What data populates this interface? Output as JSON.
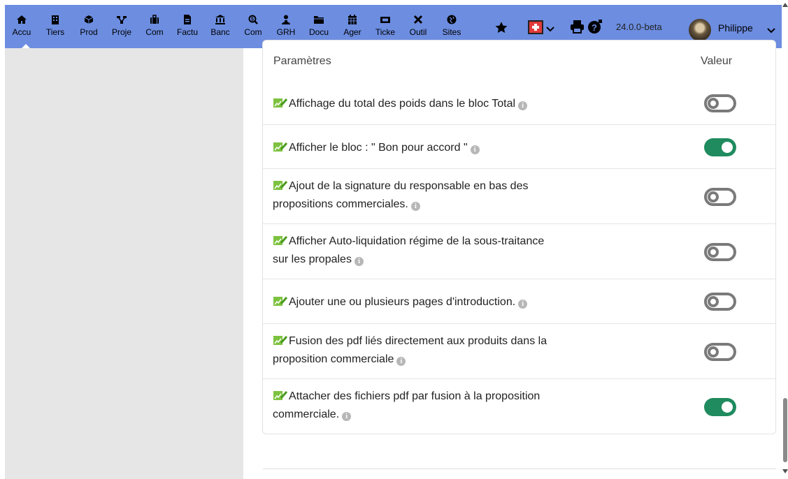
{
  "topbar": {
    "menu": [
      {
        "id": "home",
        "label": "Accu",
        "icon": "home-icon"
      },
      {
        "id": "thirdparties",
        "label": "Tiers",
        "icon": "building-icon"
      },
      {
        "id": "products",
        "label": "Prod",
        "icon": "cube-icon"
      },
      {
        "id": "projects",
        "label": "Proje",
        "icon": "project-icon"
      },
      {
        "id": "commercial",
        "label": "Com",
        "icon": "suitcase-icon"
      },
      {
        "id": "billing",
        "label": "Factu",
        "icon": "invoice-icon"
      },
      {
        "id": "bank",
        "label": "Banc",
        "icon": "bank-icon"
      },
      {
        "id": "accounting",
        "label": "Com",
        "icon": "search-dollar-icon"
      },
      {
        "id": "hrm",
        "label": "GRH",
        "icon": "users-icon"
      },
      {
        "id": "documents",
        "label": "Docu",
        "icon": "folder-icon"
      },
      {
        "id": "agenda",
        "label": "Ager",
        "icon": "calendar-icon"
      },
      {
        "id": "ticket",
        "label": "Ticke",
        "icon": "ticket-icon"
      },
      {
        "id": "tools",
        "label": "Outil",
        "icon": "tools-icon"
      },
      {
        "id": "sites",
        "label": "Sites",
        "icon": "globe-icon"
      }
    ],
    "version": "24.0.0-beta",
    "username": "Philippe",
    "colors": {
      "bar": "#6c8de0",
      "flag": "#e23b3b"
    }
  },
  "table": {
    "col_param": "Paramètres",
    "col_value": "Valeur",
    "rows": [
      {
        "l1": "Affichage du total des poids dans le bloc Total",
        "l2": "",
        "on": false
      },
      {
        "l1": "Afficher le bloc : \" Bon pour accord \"",
        "l2": "",
        "on": true
      },
      {
        "l1": "Ajout de la signature du responsable en bas des",
        "l2": "propositions commerciales.",
        "on": false
      },
      {
        "l1": "Afficher Auto-liquidation régime de la sous-traitance",
        "l2": "sur les propales",
        "on": false
      },
      {
        "l1": "Ajouter une ou plusieurs pages d'introduction.",
        "l2": "",
        "on": false
      },
      {
        "l1": "Fusion des pdf liés directement aux produits dans la",
        "l2": "proposition commerciale",
        "on": false
      },
      {
        "l1": "Attacher des fichiers pdf par fusion à la proposition",
        "l2": "commerciale.",
        "on": true
      }
    ],
    "colors": {
      "toggle_on": "#1f8b5f",
      "toggle_off": "#7a7a7a"
    }
  }
}
